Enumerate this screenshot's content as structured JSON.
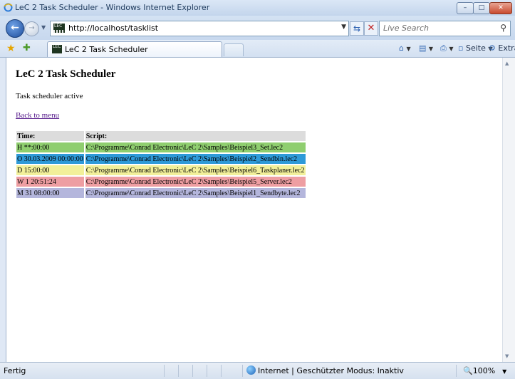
{
  "window": {
    "title": "LeC 2 Task Scheduler - Windows Internet Explorer",
    "controls": {
      "minimize": "–",
      "maximize": "□",
      "close": "✕"
    }
  },
  "address_bar": {
    "url": "http://localhost/tasklist",
    "favicon_text": "LEC"
  },
  "search": {
    "placeholder": "Live Search"
  },
  "tabs": [
    {
      "label": "LeC 2 Task Scheduler",
      "active": true
    }
  ],
  "command_bar": {
    "page_label": "Seite",
    "tools_label": "Extras"
  },
  "page": {
    "heading": "LeC 2 Task Scheduler",
    "status": "Task scheduler active",
    "back_link": "Back to menu",
    "table": {
      "headers": [
        "Time:",
        "Script:"
      ],
      "rows": [
        {
          "time": "H **:00:00",
          "script": "C:\\Programme\\Conrad Electronic\\LeC 2\\Samples\\Beispiel3_Set.lec2",
          "color": "#8fce6f"
        },
        {
          "time": "O 30.03.2009 00:00:00",
          "script": "C:\\Programme\\Conrad Electronic\\LeC 2\\Samples\\Beispiel2_Sendbin.lec2",
          "color": "#2e9ad8"
        },
        {
          "time": "D 15:00:00",
          "script": "C:\\Programme\\Conrad Electronic\\LeC 2\\Samples\\Beispiel6_Taskplaner.lec2",
          "color": "#f2f09a"
        },
        {
          "time": "W 1 20:51:24",
          "script": "C:\\Programme\\Conrad Electronic\\LeC 2\\Samples\\Beispiel5_Server.lec2",
          "color": "#ee9ea2"
        },
        {
          "time": "M 31 08:00:00",
          "script": "C:\\Programme\\Conrad Electronic\\LeC 2\\Samples\\Beispiel1_Sendbyte.lec2",
          "color": "#b4b6dc"
        }
      ]
    }
  },
  "status_bar": {
    "status": "Fertig",
    "zone": "Internet | Geschützter Modus: Inaktiv",
    "zoom": "100%"
  }
}
